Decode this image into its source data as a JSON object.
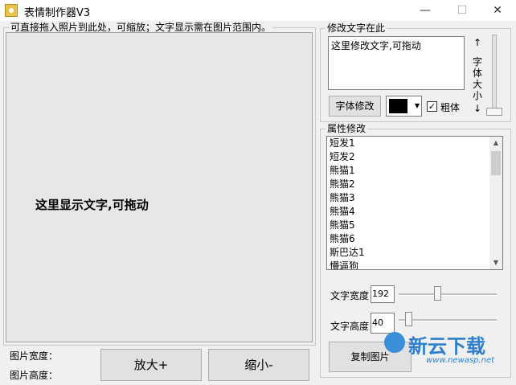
{
  "window": {
    "title": "表情制作器V3",
    "min_icon": "—",
    "max_icon": "☐",
    "close_icon": "✕"
  },
  "left_panel": {
    "hint": "可直接拖入照片到此处，可缩放；文字显示需在图片范围内。",
    "canvas_text": "这里显示文字,可拖动",
    "width_label": "图片宽度：",
    "height_label": "图片高度：",
    "zoom_in_label": "放大+",
    "zoom_out_label": "缩小-"
  },
  "text_group": {
    "title": "修改文字在此",
    "textarea_value": "这里修改文字,可拖动",
    "font_button_label": "字体修改",
    "color": "#000000",
    "bold_label": "粗体",
    "bold_checked": true,
    "check_mark": "✓",
    "size_up_arrow": "↑",
    "size_label": "字体大小",
    "size_down_arrow": "↓"
  },
  "attr_group": {
    "title": "属性修改",
    "items": [
      "短发1",
      "短发2",
      "熊猫1",
      "熊猫2",
      "熊猫3",
      "熊猫4",
      "熊猫5",
      "熊猫6",
      "斯巴达1",
      "懵逼狗"
    ],
    "text_width_label": "文字宽度",
    "text_width_value": "192",
    "text_height_label": "文字高度",
    "text_height_value": "40",
    "copy_button_label": "复制图片"
  },
  "watermark": {
    "title": "新云下载",
    "url": "www.newasp.net"
  }
}
